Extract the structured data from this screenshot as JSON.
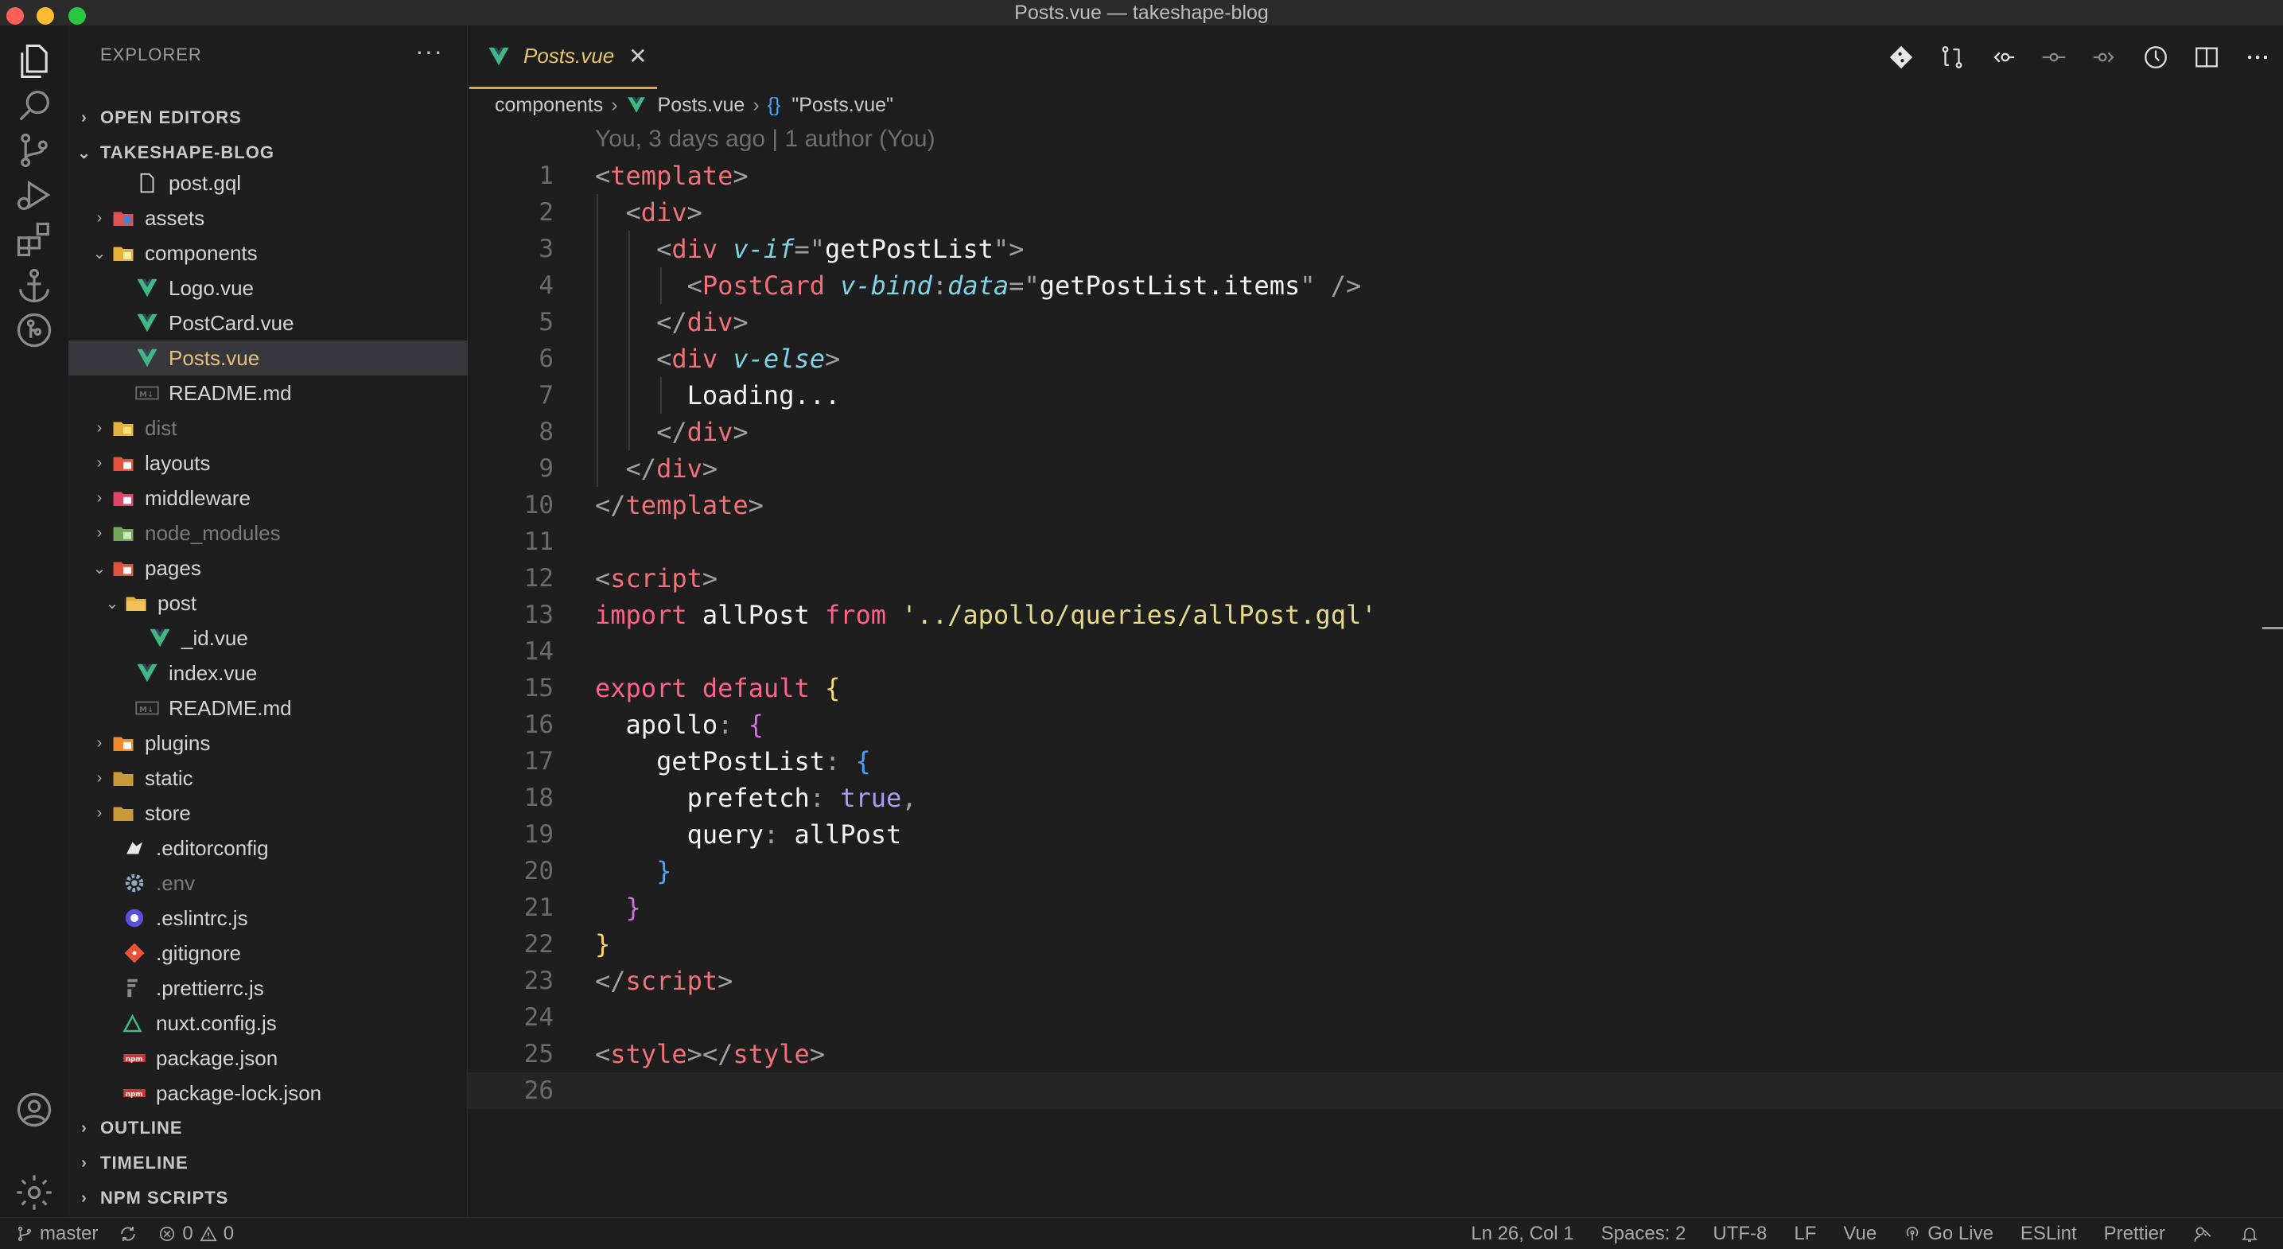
{
  "window": {
    "title": "Posts.vue — takeshape-blog"
  },
  "activity_bar": [
    "explorer-icon",
    "search-icon",
    "source-control-icon",
    "run-debug-icon",
    "extensions-icon",
    "anchor-icon",
    "git-graph-icon",
    "account-icon",
    "settings-gear-icon"
  ],
  "sidebar": {
    "title": "EXPLORER",
    "more": "···",
    "sections": {
      "open_editors": "OPEN EDITORS",
      "project": "TAKESHAPE-BLOG",
      "outline": "OUTLINE",
      "timeline": "TIMELINE",
      "npm_scripts": "NPM SCRIPTS"
    },
    "tree": [
      {
        "label": "post.gql",
        "icon": "file-icon"
      },
      {
        "label": "assets",
        "icon": "folder-assets-icon"
      },
      {
        "label": "components",
        "icon": "folder-components-icon"
      },
      {
        "label": "Logo.vue",
        "icon": "vue-icon"
      },
      {
        "label": "PostCard.vue",
        "icon": "vue-icon"
      },
      {
        "label": "Posts.vue",
        "icon": "vue-icon"
      },
      {
        "label": "README.md",
        "icon": "markdown-icon"
      },
      {
        "label": "dist",
        "icon": "folder-dist-icon"
      },
      {
        "label": "layouts",
        "icon": "folder-layouts-icon"
      },
      {
        "label": "middleware",
        "icon": "folder-middleware-icon"
      },
      {
        "label": "node_modules",
        "icon": "folder-node-icon"
      },
      {
        "label": "pages",
        "icon": "folder-pages-icon"
      },
      {
        "label": "post",
        "icon": "folder-icon"
      },
      {
        "label": "_id.vue",
        "icon": "vue-icon"
      },
      {
        "label": "index.vue",
        "icon": "vue-icon"
      },
      {
        "label": "README.md",
        "icon": "markdown-icon"
      },
      {
        "label": "plugins",
        "icon": "folder-plugins-icon"
      },
      {
        "label": "static",
        "icon": "folder-icon"
      },
      {
        "label": "store",
        "icon": "folder-icon"
      },
      {
        "label": ".editorconfig",
        "icon": "editorconfig-icon"
      },
      {
        "label": ".env",
        "icon": "gear-icon"
      },
      {
        "label": ".eslintrc.js",
        "icon": "eslint-icon"
      },
      {
        "label": ".gitignore",
        "icon": "git-icon"
      },
      {
        "label": ".prettierrc.js",
        "icon": "prettier-icon"
      },
      {
        "label": "nuxt.config.js",
        "icon": "nuxt-icon"
      },
      {
        "label": "package.json",
        "icon": "npm-icon"
      },
      {
        "label": "package-lock.json",
        "icon": "npm-icon"
      }
    ]
  },
  "tab": {
    "label": "Posts.vue",
    "close": "✕"
  },
  "breadcrumb": {
    "folder": "components",
    "file": "Posts.vue",
    "symbol": "\"Posts.vue\"",
    "braces": "{}"
  },
  "blame": "You, 3 days ago | 1 author (You)",
  "code": {
    "line_numbers": [
      "1",
      "2",
      "3",
      "4",
      "5",
      "6",
      "7",
      "8",
      "9",
      "10",
      "11",
      "12",
      "13",
      "14",
      "15",
      "16",
      "17",
      "18",
      "19",
      "20",
      "21",
      "22",
      "23",
      "24",
      "25",
      "26"
    ],
    "tokens": {
      "t1a": "<",
      "t1b": "template",
      "t1c": ">",
      "t2a": "<",
      "t2b": "div",
      "t2c": ">",
      "t3a": "<",
      "t3b": "div",
      "t3c": "v-if",
      "t3d": "=\"",
      "t3e": "getPostList",
      "t3f": "\">",
      "t4a": "<",
      "t4b": "PostCard",
      "t4c": "v-bind",
      "t4d": ":",
      "t4e": "data",
      "t4f": "=\"",
      "t4g": "getPostList.items",
      "t4h": "\" />",
      "t5a": "</",
      "t5b": "div",
      "t5c": ">",
      "t6a": "<",
      "t6b": "div",
      "t6c": "v-else",
      "t6d": ">",
      "t7a": "Loading...",
      "t8a": "</",
      "t8b": "div",
      "t8c": ">",
      "t9a": "</",
      "t9b": "div",
      "t9c": ">",
      "t10a": "</",
      "t10b": "template",
      "t10c": ">",
      "t12a": "<",
      "t12b": "script",
      "t12c": ">",
      "t13a": "import",
      "t13b": "allPost",
      "t13c": "from",
      "t13d": "'../apollo/queries/allPost.gql'",
      "t15a": "export",
      "t15b": "default",
      "t15c": "{",
      "t16a": "apollo",
      "t16b": ":",
      "t16c": "{",
      "t17a": "getPostList",
      "t17b": ":",
      "t17c": "{",
      "t18a": "prefetch",
      "t18b": ":",
      "t18c": "true",
      "t18d": ",",
      "t19a": "query",
      "t19b": ":",
      "t19c": "allPost",
      "t20a": "}",
      "t21a": "}",
      "t22a": "}",
      "t23a": "</",
      "t23b": "script",
      "t23c": ">",
      "t25a": "<",
      "t25b": "style",
      "t25c": "></",
      "t25d": "style",
      "t25e": ">"
    }
  },
  "status": {
    "branch": "master",
    "errors": "0",
    "warnings": "0",
    "position": "Ln 26, Col 1",
    "spaces": "Spaces: 2",
    "encoding": "UTF-8",
    "eol": "LF",
    "language": "Vue",
    "go_live": "Go Live",
    "eslint": "ESLint",
    "prettier": "Prettier"
  },
  "colors": {
    "accent": "#e5a93a",
    "vue": "#41b883",
    "tag": "#f07178",
    "keyword": "#ff6188",
    "string": "#e8d98a"
  }
}
